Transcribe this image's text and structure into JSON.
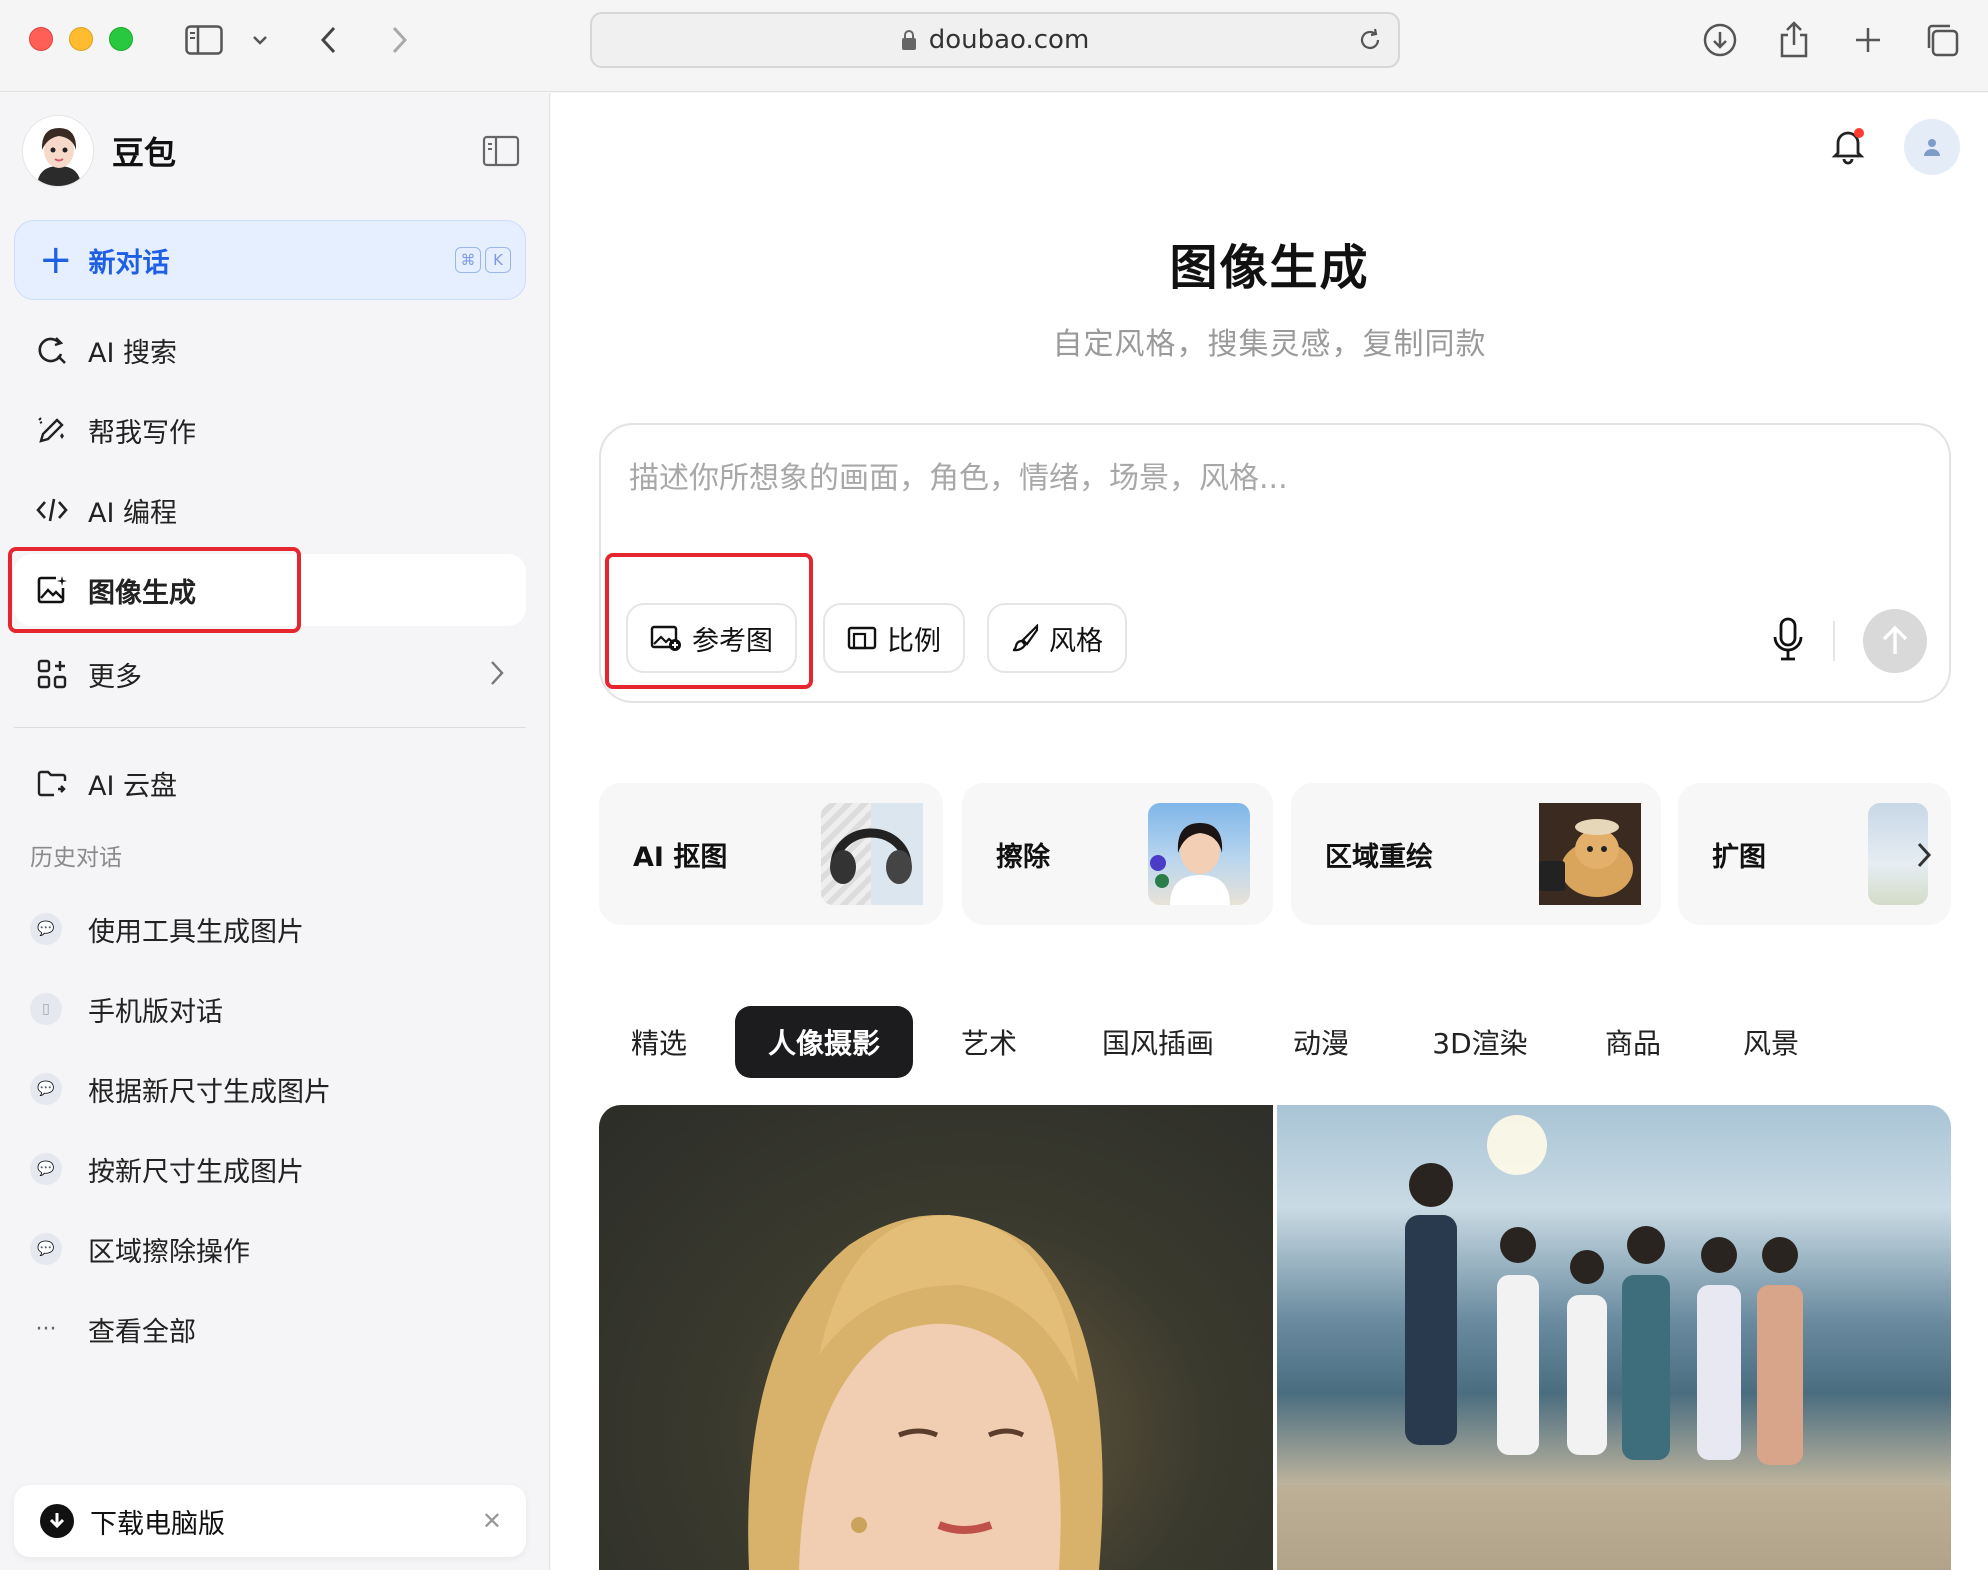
{
  "browser": {
    "url": "doubao.com"
  },
  "sidebar": {
    "brand": "豆包",
    "new_chat": {
      "label": "新对话",
      "shortcut": [
        "⌘",
        "K"
      ]
    },
    "nav": [
      {
        "label": "AI 搜索",
        "icon": "search-refresh-icon"
      },
      {
        "label": "帮我写作",
        "icon": "pen-icon"
      },
      {
        "label": "AI 编程",
        "icon": "code-icon"
      },
      {
        "label": "图像生成",
        "icon": "image-sparkle-icon",
        "active": true
      },
      {
        "label": "更多",
        "icon": "grid-plus-icon"
      }
    ],
    "cloud": {
      "label": "AI 云盘",
      "icon": "folder-icon"
    },
    "history_title": "历史对话",
    "history": [
      {
        "label": "使用工具生成图片"
      },
      {
        "label": "手机版对话"
      },
      {
        "label": "根据新尺寸生成图片"
      },
      {
        "label": "按新尺寸生成图片"
      },
      {
        "label": "区域擦除操作"
      }
    ],
    "view_all": "查看全部",
    "download": {
      "label": "下载电脑版"
    }
  },
  "main": {
    "title": "图像生成",
    "subtitle": "自定风格，搜集灵感，复制同款",
    "prompt": {
      "placeholder": "描述你所想象的画面，角色，情绪，场景，风格...",
      "value": "",
      "chips": [
        {
          "label": "参考图",
          "icon": "image-add-icon"
        },
        {
          "label": "比例",
          "icon": "aspect-ratio-icon"
        },
        {
          "label": "风格",
          "icon": "brush-icon"
        }
      ]
    },
    "tools": [
      {
        "label": "AI 抠图"
      },
      {
        "label": "擦除"
      },
      {
        "label": "区域重绘"
      },
      {
        "label": "扩图"
      }
    ],
    "categories": [
      {
        "label": "精选"
      },
      {
        "label": "人像摄影",
        "active": true
      },
      {
        "label": "艺术"
      },
      {
        "label": "国风插画"
      },
      {
        "label": "动漫"
      },
      {
        "label": "3D渲染"
      },
      {
        "label": "商品"
      },
      {
        "label": "风景"
      }
    ]
  },
  "colors": {
    "accent": "#1f5fe6",
    "highlight": "#e6262e",
    "active_tab_bg": "#1c1c1e"
  }
}
